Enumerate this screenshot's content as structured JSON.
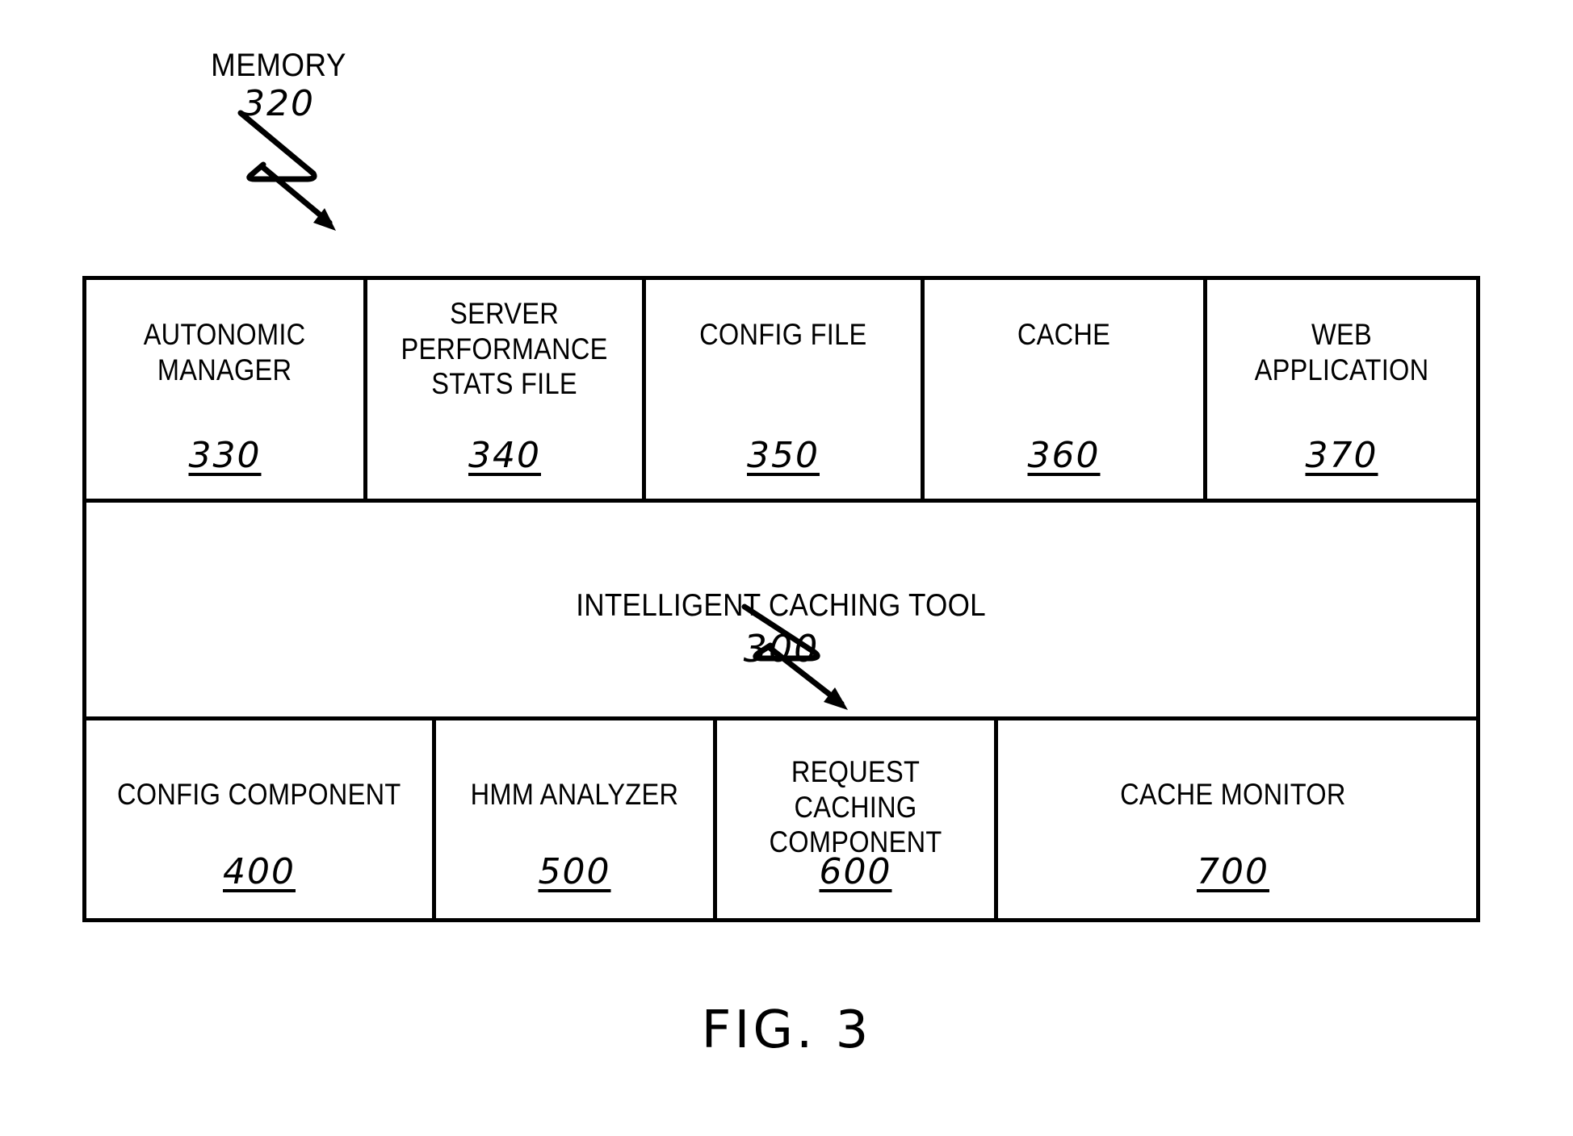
{
  "figure": {
    "caption": "FIG. 3"
  },
  "callouts": {
    "memory": {
      "label": "MEMORY",
      "ref": "320"
    },
    "tool": {
      "label": "INTELLIGENT CACHING TOOL",
      "ref": "300"
    }
  },
  "top_row": [
    {
      "label": "AUTONOMIC\nMANAGER",
      "ref": "330"
    },
    {
      "label": "SERVER\nPERFORMANCE\nSTATS FILE",
      "ref": "340"
    },
    {
      "label": "CONFIG FILE",
      "ref": "350"
    },
    {
      "label": "CACHE",
      "ref": "360"
    },
    {
      "label": "WEB APPLICATION",
      "ref": "370"
    }
  ],
  "bottom_row": [
    {
      "label": "CONFIG COMPONENT",
      "ref": "400"
    },
    {
      "label": "HMM ANALYZER",
      "ref": "500"
    },
    {
      "label": "REQUEST CACHING\nCOMPONENT",
      "ref": "600"
    },
    {
      "label": "CACHE MONITOR",
      "ref": "700"
    }
  ],
  "colors": {
    "ink": "#000000",
    "paper": "#ffffff"
  }
}
